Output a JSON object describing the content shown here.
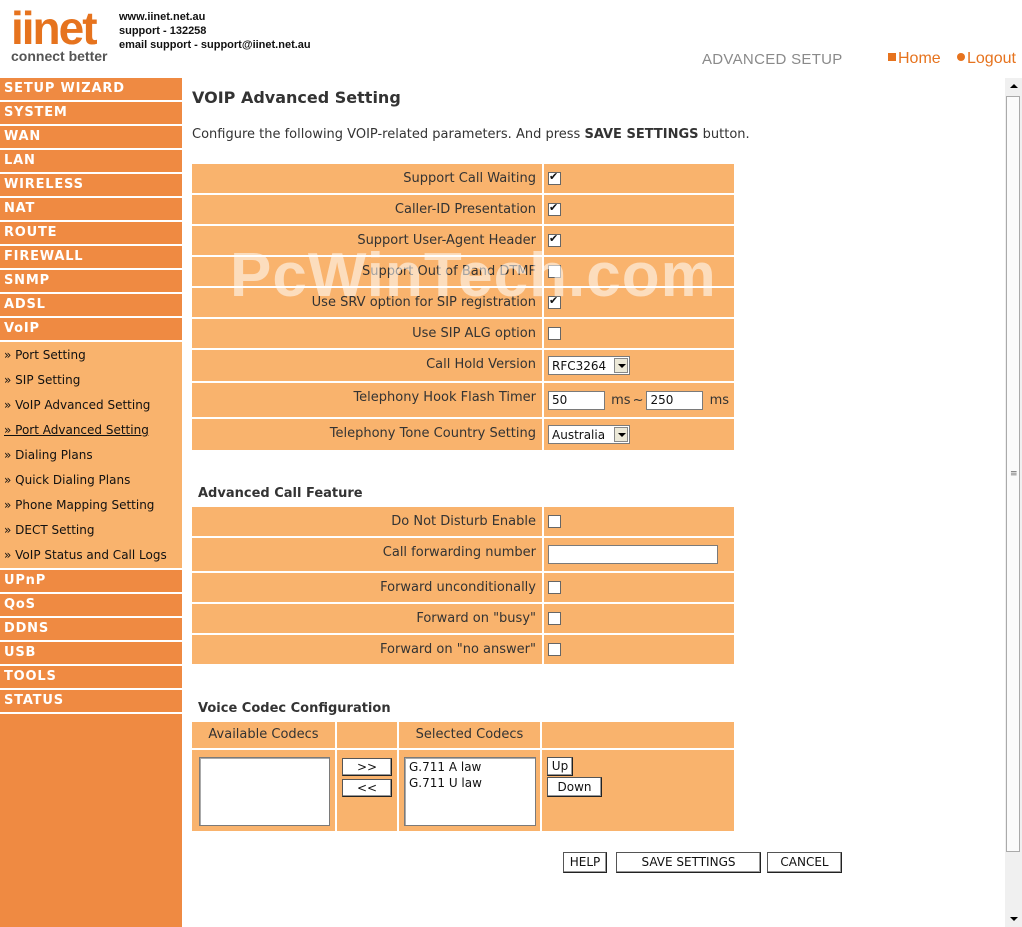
{
  "header": {
    "logo_text": "iinet",
    "logo_tagline": "connect better",
    "contact": [
      "www.iinet.net.au",
      "support - 132258",
      "email support - support@iinet.net.au"
    ],
    "section_label": "ADVANCED SETUP",
    "home_link": "Home",
    "logout_link": "Logout"
  },
  "sidebar": {
    "top_items": [
      "SETUP WIZARD",
      "SYSTEM",
      "WAN",
      "LAN",
      "WIRELESS",
      "NAT",
      "ROUTE",
      "FIREWALL",
      "SNMP",
      "ADSL",
      "VoIP"
    ],
    "sub_items": [
      "» Port Setting",
      "» SIP Setting",
      "» VoIP Advanced Setting",
      "» Port Advanced Setting",
      "» Dialing Plans",
      "» Quick Dialing Plans",
      "» Phone Mapping Setting",
      "» DECT Setting",
      "» VoIP Status and Call Logs"
    ],
    "active_sub": "» Port Advanced Setting",
    "bottom_items": [
      "UPnP",
      "QoS",
      "DDNS",
      "USB",
      "TOOLS",
      "STATUS"
    ]
  },
  "page": {
    "title": "VOIP Advanced Setting",
    "intro_prefix": "Configure the following VOIP-related parameters. And press ",
    "intro_bold": "SAVE SETTINGS",
    "intro_suffix": " button."
  },
  "voip_settings": {
    "support_call_waiting": {
      "label": "Support Call Waiting",
      "checked": true
    },
    "caller_id": {
      "label": "Caller-ID Presentation",
      "checked": true
    },
    "user_agent": {
      "label": "Support User-Agent Header",
      "checked": true
    },
    "out_of_band_dtmf": {
      "label": "Support Out of Band DTMF",
      "checked": false
    },
    "srv_option": {
      "label": "Use SRV option for SIP registration",
      "checked": true
    },
    "sip_alg": {
      "label": "Use SIP ALG option",
      "checked": false
    },
    "call_hold": {
      "label": "Call Hold Version",
      "value": "RFC3264"
    },
    "hook_flash": {
      "label": "Telephony Hook Flash Timer",
      "min": "50",
      "max": "250",
      "unit": "ms",
      "separator": "~"
    },
    "tone_country": {
      "label": "Telephony Tone Country Setting",
      "value": "Australia"
    }
  },
  "call_features": {
    "title": "Advanced Call Feature",
    "dnd": {
      "label": "Do Not Disturb Enable",
      "checked": false
    },
    "forward_number": {
      "label": "Call forwarding number",
      "value": ""
    },
    "forward_uncond": {
      "label": "Forward unconditionally",
      "checked": false
    },
    "forward_busy": {
      "label": "Forward on \"busy\"",
      "checked": false
    },
    "forward_noanswer": {
      "label": "Forward on \"no answer\"",
      "checked": false
    }
  },
  "codec": {
    "title": "Voice Codec Configuration",
    "available_header": "Available Codecs",
    "selected_header": "Selected Codecs",
    "available": [],
    "selected": [
      "G.711 A law",
      "G.711 U law"
    ],
    "add_btn": ">>",
    "remove_btn": "<<",
    "up_btn": "Up",
    "down_btn": "Down"
  },
  "footer_buttons": {
    "help": "HELP",
    "save": "SAVE SETTINGS",
    "cancel": "CANCEL"
  },
  "watermark": "PcWinTech.com",
  "colors": {
    "sidebar": "#ef8a42",
    "submenu": "#f9b36d",
    "form_bg": "#f9b36d",
    "accent": "#e6731e"
  }
}
